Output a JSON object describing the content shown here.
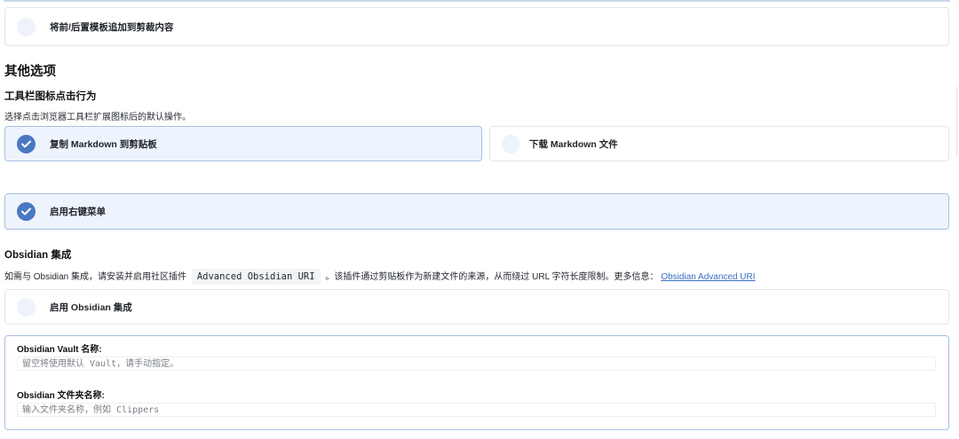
{
  "template_append": {
    "label": "将前/后置模板追加到剪裁内容",
    "checked": false
  },
  "other_options": {
    "title": "其他选项",
    "toolbar_action": {
      "title": "工具栏图标点击行为",
      "description": "选择点击浏览器工具栏扩展图标后的默认操作。",
      "options": [
        {
          "label": "复制 Markdown 到剪贴板",
          "selected": true
        },
        {
          "label": "下载 Markdown 文件",
          "selected": false
        }
      ]
    },
    "context_menu": {
      "label": "启用右键菜单",
      "checked": true
    }
  },
  "obsidian": {
    "title": "Obsidian 集成",
    "description_before": "如需与 Obsidian 集成，请安装并启用社区插件",
    "plugin_name": "Advanced Obsidian URI",
    "description_after": "。该插件通过剪贴板作为新建文件的来源，从而绕过 URL 字符长度限制。更多信息：",
    "link_text": "Obsidian Advanced URI",
    "enable": {
      "label": "启用 Obsidian 集成",
      "checked": false
    },
    "vault": {
      "label": "Obsidian Vault 名称:",
      "placeholder": "留空将使用默认 Vault，请手动指定。",
      "value": ""
    },
    "folder": {
      "label": "Obsidian 文件夹名称:",
      "placeholder": "输入文件夹名称，例如 Clippers",
      "value": ""
    }
  },
  "colors": {
    "accent": "#4a78c2",
    "selected_bg": "#eef4fd",
    "link": "#3a6fc1"
  },
  "icons": {
    "checked": "check-icon",
    "unchecked": "empty-circle-icon"
  }
}
